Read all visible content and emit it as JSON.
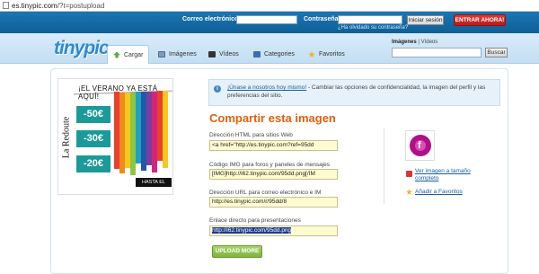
{
  "browser": {
    "url_domain": "es.tinypic.com",
    "url_path": "/?t=postupload"
  },
  "topbar": {
    "email_label": "Correo electrónico:",
    "password_label": "Contraseña:",
    "login_button": "Iniciar sesión",
    "join_button": "ENTRAR AHORA!",
    "forgot_link": "¿Ha olvidado su contraseña?"
  },
  "header": {
    "logo_text": "tinypic",
    "tabs": [
      {
        "label": "Cargar",
        "active": true
      },
      {
        "label": "Imágenes",
        "active": false
      },
      {
        "label": "Vídeos",
        "active": false
      },
      {
        "label": "Categories",
        "active": false
      },
      {
        "label": "Favoritos",
        "active": false
      }
    ],
    "search_scope_images": "Imágenes",
    "search_scope_sep": "|",
    "search_scope_videos": "Vídeos",
    "search_button": "Buscar"
  },
  "ad": {
    "headline": "¡EL VERANO YA ESTÁ AQUÍ!",
    "brand": "La Redoute",
    "discounts": [
      "-50€",
      "-30€",
      "-20€"
    ],
    "deadline": "HASTA EL 19/06"
  },
  "info": {
    "link_text": "¡Únase a nosotros hoy mismo!",
    "body_text": " - Cambiar las opciones de confidencialidad, la imagen del perfil y las preferencias del sitio."
  },
  "share": {
    "title": "Compartir esta imagen",
    "fields": [
      {
        "label": "Dirección HTML para sitios Web",
        "value": "<a href=\"http://es.tinypic.com?ref=95dd"
      },
      {
        "label": "Código IMG para foros y paneles de mensajes",
        "value": "[IMG]http://i62.tinypic.com/95dd.png[/IM"
      },
      {
        "label": "Dirección URL para correo electrónico e IM",
        "value": "http://es.tinypic.com/r/95dd/8"
      },
      {
        "label": "Enlace directo para presentaciones",
        "value": "http://i62.tinypic.com/95dd.png"
      }
    ],
    "upload_more": "UPLOAD MORE"
  },
  "sidebar": {
    "view_full": "Ver imagen a tamaño completo",
    "add_favorites": "Añadir a Favoritos"
  },
  "colors": {
    "accent_orange": "#e05f10",
    "brand_blue": "#1a76b4",
    "join_red": "#c9221f",
    "upload_green": "#7db43d"
  }
}
